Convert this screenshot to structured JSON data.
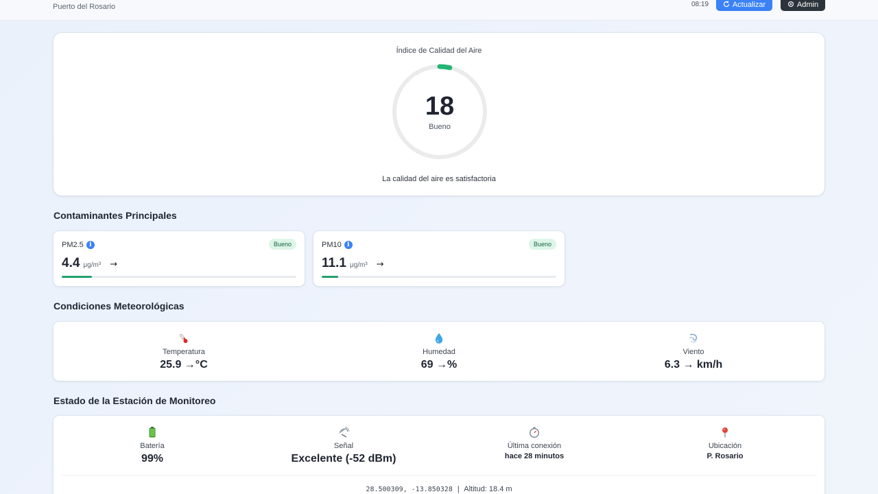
{
  "header": {
    "subtitle": "Puerto del Rosario",
    "time": "08:19",
    "refresh_label": "Actualizar",
    "admin_label": "Admin"
  },
  "aqi": {
    "title": "Índice de Calidad del Aire",
    "value": "18",
    "fraction": 0.036,
    "level": "Bueno",
    "description": "La calidad del aire es satisfactoria",
    "color": "#22b573"
  },
  "pollutants": {
    "title": "Contaminantes Principales",
    "items": [
      {
        "name": "PM2.5",
        "info": "i",
        "badge": "Bueno",
        "value": "4.4",
        "unit": "μg/m³",
        "trend": "→",
        "fraction": 0.13
      },
      {
        "name": "PM10",
        "info": "i",
        "badge": "Bueno",
        "value": "11.1",
        "unit": "μg/m³",
        "trend": "→",
        "fraction": 0.07
      }
    ]
  },
  "weather": {
    "title": "Condiciones Meteorológicas",
    "items": [
      {
        "icon": "thermometer-icon",
        "label": "Temperatura",
        "value": "25.9 →°C"
      },
      {
        "icon": "droplet-icon",
        "label": "Humedad",
        "value": "69 →%"
      },
      {
        "icon": "wind-icon",
        "label": "Viento",
        "value": "6.3 → km/h"
      }
    ]
  },
  "station": {
    "title": "Estado de la Estación de Monitoreo",
    "items": [
      {
        "icon": "battery-icon",
        "label": "Batería",
        "value": "99%"
      },
      {
        "icon": "satellite-icon",
        "label": "Señal",
        "value": "Excelente (-52 dBm)"
      },
      {
        "icon": "stopwatch-icon",
        "label": "Última conexión",
        "value": "hace 28 minutos"
      },
      {
        "icon": "location-pin-icon",
        "label": "Ubicación",
        "value": "P. Rosario"
      }
    ],
    "coordinates": "28.500309, -13.850328",
    "separator": "|",
    "altitude": "Altitud: 18.4 m"
  },
  "colors": {
    "primary": "#3b82f6",
    "dark": "#2d333b",
    "good": "#22a06b",
    "good_bg": "#dcf5e8"
  }
}
